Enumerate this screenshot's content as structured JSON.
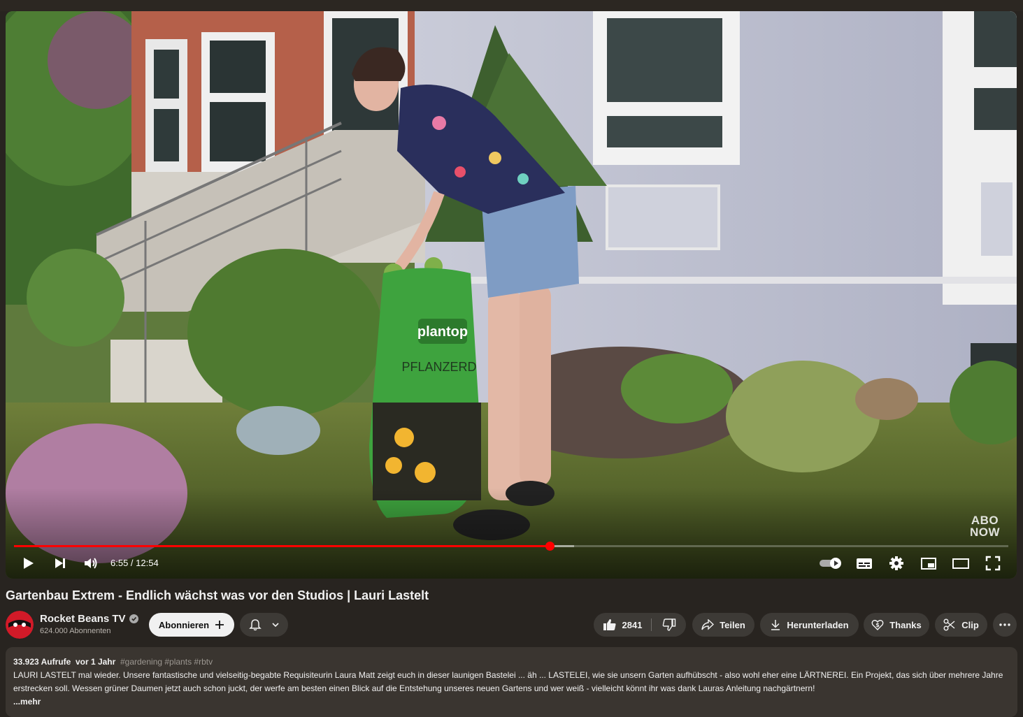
{
  "video": {
    "title": "Gartenbau Extrem - Endlich wächst was vor den Studios | Lauri Lastelt",
    "watermark_line1": "ABO",
    "watermark_line2": "NOW",
    "time_display": "6:55 / 12:54",
    "progress": {
      "played_fraction": 0.539,
      "buffered_fraction": 0.563
    },
    "bag_brand": "plantop",
    "bag_label": "PFLANZERD"
  },
  "controls": {
    "play_icon": "play-icon",
    "next_icon": "next-icon",
    "volume_icon": "volume-icon",
    "autoplay_icon": "autoplay-toggle-icon",
    "subtitles_icon": "subtitles-icon",
    "settings_icon": "gear-icon",
    "miniplayer_icon": "miniplayer-icon",
    "theater_icon": "theater-icon",
    "fullscreen_icon": "fullscreen-icon"
  },
  "channel": {
    "name": "Rocket Beans TV",
    "subscribers": "624.000 Abonnenten",
    "subscribe_label": "Abonnieren"
  },
  "actions": {
    "likes": "2841",
    "share": "Teilen",
    "download": "Herunterladen",
    "thanks": "Thanks",
    "clip": "Clip"
  },
  "description": {
    "views": "33.923 Aufrufe",
    "age": "vor 1 Jahr",
    "tags": "#gardening #plants #rbtv",
    "text": "LAURI LASTELT mal wieder. Unsere fantastische und vielseitig-begabte Requisiteurin Laura Matt zeigt euch in dieser launigen Bastelei ... äh ... LASTELEI, wie sie unsern Garten aufhübscht - also wohl eher eine LÄRTNEREI. Ein Projekt, das sich über mehrere Jahre erstrecken soll. Wessen grüner Daumen jetzt auch schon juckt, der werfe am besten einen Blick auf die Entstehung unseres neuen Gartens und wer weiß - vielleicht könnt ihr was dank Lauras Anleitung nachgärtnern!",
    "more": "...mehr"
  },
  "colors": {
    "accent": "#ff0000",
    "page_bg": "#282420",
    "description_bg": "#3a3530"
  }
}
